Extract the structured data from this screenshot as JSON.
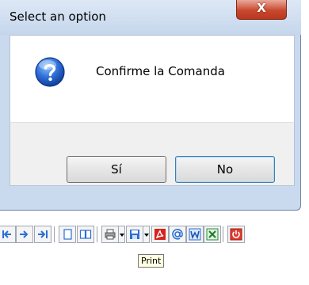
{
  "dialog": {
    "title": "Select an option",
    "close_label": "X",
    "message": "Confirme la Comanda",
    "icon": "question-icon",
    "buttons": {
      "yes": "Sí",
      "no": "No"
    }
  },
  "toolbar": {
    "icons": [
      "first-page-icon",
      "previous-page-icon",
      "next-page-icon",
      "last-page-icon",
      "single-page-icon",
      "two-pages-icon",
      "print-icon",
      "save-icon",
      "pdf-icon",
      "email-icon",
      "word-icon",
      "excel-icon",
      "exit-icon"
    ],
    "tooltip": "Print"
  },
  "colors": {
    "arrow_blue": "#2a6fd6",
    "close_red": "#c8492e",
    "pdf_red": "#d8221b",
    "tooltip_bg": "#ffffe1"
  }
}
